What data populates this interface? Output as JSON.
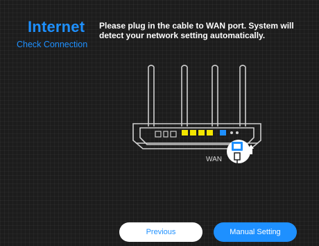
{
  "header": {
    "title": "Internet",
    "subtitle": "Check Connection"
  },
  "instruction": "Please plug in the cable to WAN port. System will detect your network setting automatically.",
  "illustration": {
    "port_label": "WAN",
    "icons": [
      "router-icon",
      "ethernet-cable-icon",
      "arrow-up-icon"
    ]
  },
  "buttons": {
    "previous": "Previous",
    "manual": "Manual Setting"
  },
  "colors": {
    "accent": "#1e90ff",
    "background": "#1c1c1c",
    "lan_ports": "#f3e600"
  }
}
